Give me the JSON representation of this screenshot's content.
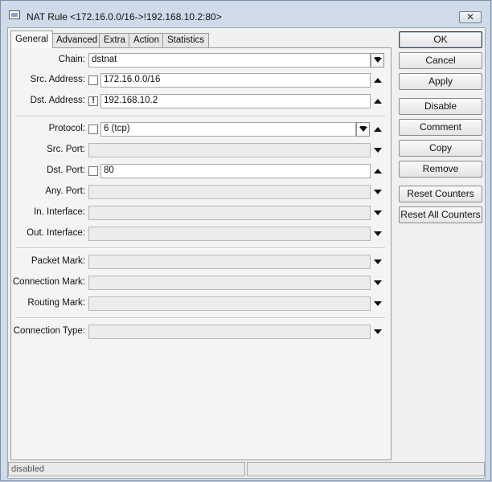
{
  "window": {
    "title": "NAT Rule <172.16.0.0/16->!192.168.10.2:80>",
    "close_glyph": "✕"
  },
  "tabs": [
    "General",
    "Advanced",
    "Extra",
    "Action",
    "Statistics"
  ],
  "active_tab": "General",
  "form": {
    "chain": {
      "label": "Chain:",
      "value": "dstnat"
    },
    "src_address": {
      "label": "Src. Address:",
      "value": "172.16.0.0/16",
      "negate": ""
    },
    "dst_address": {
      "label": "Dst. Address:",
      "value": "192.168.10.2",
      "negate": "!"
    },
    "protocol": {
      "label": "Protocol:",
      "value": "6 (tcp)",
      "negate": ""
    },
    "src_port": {
      "label": "Src. Port:",
      "value": ""
    },
    "dst_port": {
      "label": "Dst. Port:",
      "value": "80",
      "negate": ""
    },
    "any_port": {
      "label": "Any. Port:",
      "value": ""
    },
    "in_interface": {
      "label": "In. Interface:",
      "value": ""
    },
    "out_interface": {
      "label": "Out. Interface:",
      "value": ""
    },
    "packet_mark": {
      "label": "Packet Mark:",
      "value": ""
    },
    "connection_mark": {
      "label": "Connection Mark:",
      "value": ""
    },
    "routing_mark": {
      "label": "Routing Mark:",
      "value": ""
    },
    "connection_type": {
      "label": "Connection Type:",
      "value": ""
    }
  },
  "buttons": {
    "ok": "OK",
    "cancel": "Cancel",
    "apply": "Apply",
    "disable": "Disable",
    "comment": "Comment",
    "copy": "Copy",
    "remove": "Remove",
    "reset_counters": "Reset Counters",
    "reset_all_counters": "Reset All Counters"
  },
  "status": {
    "left": "disabled",
    "right": ""
  },
  "icons": {
    "window": "nat-rule-window-icon",
    "dropdown": "dropdown-select-icon",
    "up": "triangle-up-icon",
    "down": "triangle-down-icon"
  }
}
